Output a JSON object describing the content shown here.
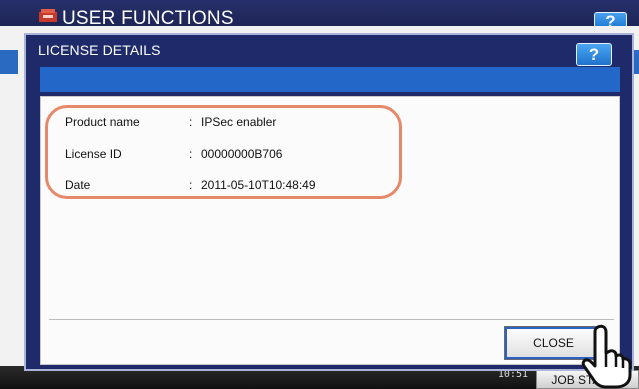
{
  "background": {
    "title": "USER FUNCTIONS",
    "help_label": "?",
    "time_text": "10:51",
    "job_status_label": "JOB STATUS"
  },
  "dialog": {
    "title": "LICENSE DETAILS",
    "help_label": "?",
    "fields": [
      {
        "label": "Product name",
        "separator": ":",
        "value": "IPSec enabler"
      },
      {
        "label": "License ID",
        "separator": ":",
        "value": "00000000B706"
      },
      {
        "label": "Date",
        "separator": ":",
        "value": "2011-05-10T10:48:49"
      }
    ],
    "close_label": "CLOSE"
  },
  "colors": {
    "header": "#1d2557",
    "dialog_frame": "#1e2a6a",
    "accent_band": "#2368c8",
    "highlight": "#e6896a"
  },
  "icons": [
    "app-logo-icon",
    "hand-pointer-icon"
  ]
}
